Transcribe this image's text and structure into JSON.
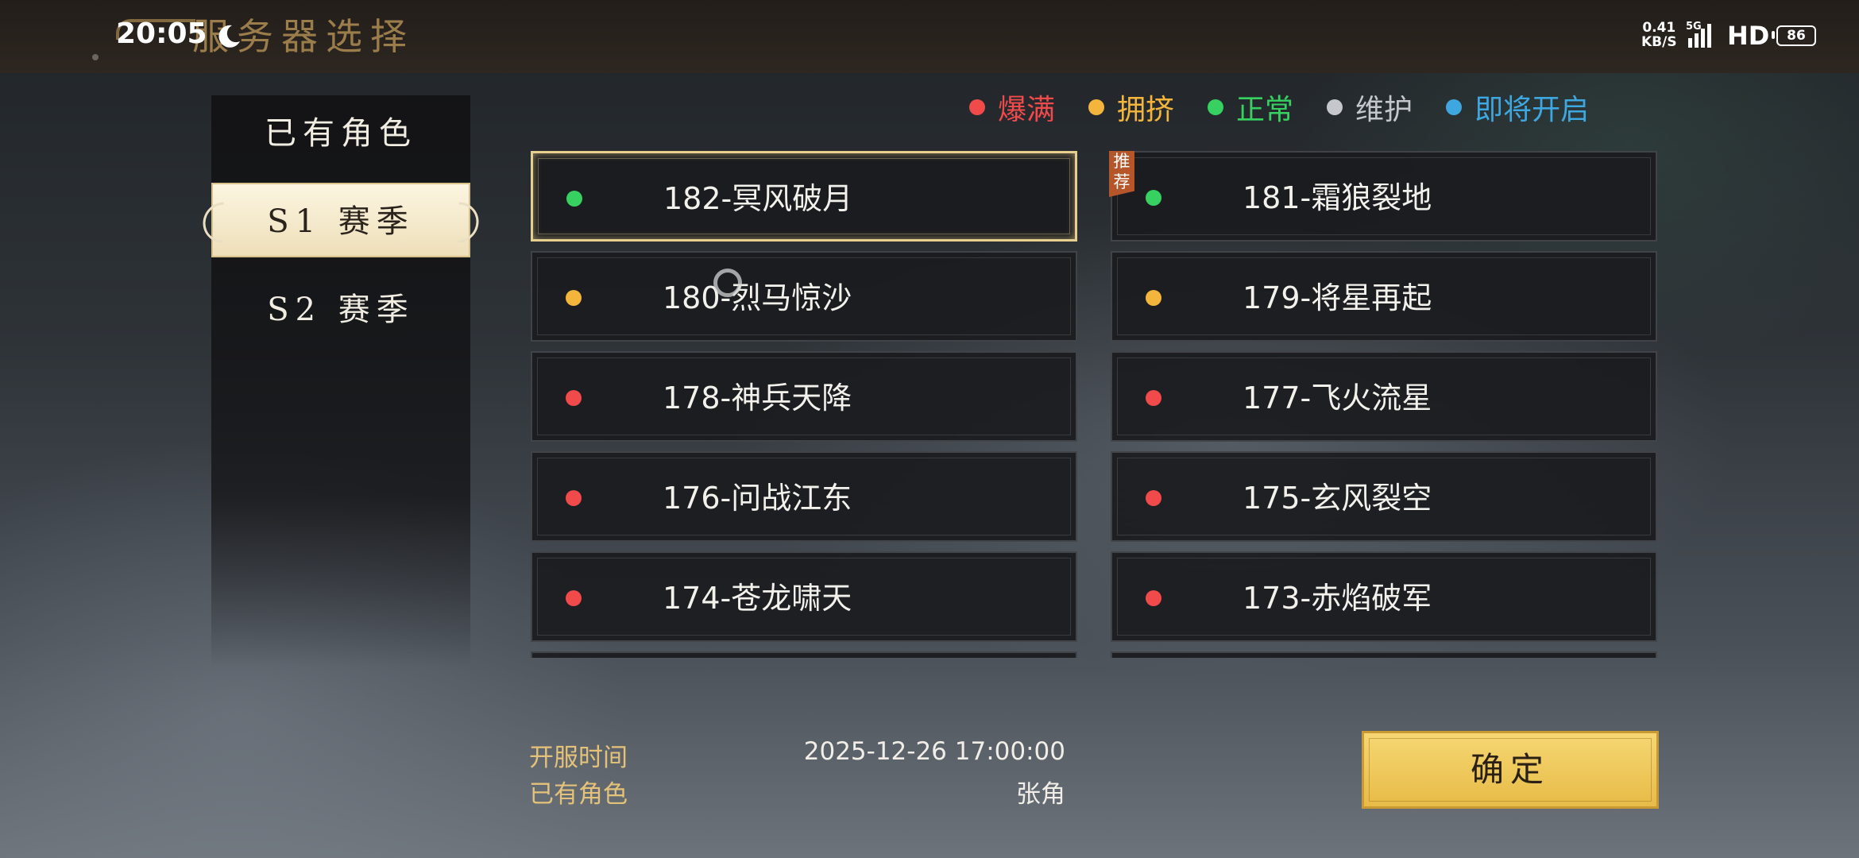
{
  "status_bar": {
    "time": "20:05",
    "net_speed_value": "0.41",
    "net_speed_unit": "KB/S",
    "network": "5G",
    "hd": "HD",
    "battery": "86"
  },
  "header": {
    "title": "服务器选择"
  },
  "sidebar": {
    "items": [
      {
        "label": "已有角色",
        "active": false
      },
      {
        "label": "S1 赛季",
        "active": true
      },
      {
        "label": "S2 赛季",
        "active": false
      }
    ]
  },
  "legend": [
    {
      "label": "爆满",
      "color": "#f04a4a"
    },
    {
      "label": "拥挤",
      "color": "#f3b53b"
    },
    {
      "label": "正常",
      "color": "#36d160"
    },
    {
      "label": "维护",
      "color": "#c4c8cc"
    },
    {
      "label": "即将开启",
      "color": "#3fa7e0"
    }
  ],
  "servers": [
    {
      "name": "182-冥风破月",
      "status": "正常",
      "color": "#36d160",
      "selected": true,
      "recommended": false
    },
    {
      "name": "181-霜狼裂地",
      "status": "正常",
      "color": "#36d160",
      "selected": false,
      "recommended": true
    },
    {
      "name": "180-烈马惊沙",
      "status": "拥挤",
      "color": "#f3b53b",
      "selected": false,
      "recommended": false
    },
    {
      "name": "179-将星再起",
      "status": "拥挤",
      "color": "#f3b53b",
      "selected": false,
      "recommended": false
    },
    {
      "name": "178-神兵天降",
      "status": "爆满",
      "color": "#f04a4a",
      "selected": false,
      "recommended": false
    },
    {
      "name": "177-飞火流星",
      "status": "爆满",
      "color": "#f04a4a",
      "selected": false,
      "recommended": false
    },
    {
      "name": "176-问战江东",
      "status": "爆满",
      "color": "#f04a4a",
      "selected": false,
      "recommended": false
    },
    {
      "name": "175-玄风裂空",
      "status": "爆满",
      "color": "#f04a4a",
      "selected": false,
      "recommended": false
    },
    {
      "name": "174-苍龙啸天",
      "status": "爆满",
      "color": "#f04a4a",
      "selected": false,
      "recommended": false
    },
    {
      "name": "173-赤焰破军",
      "status": "爆满",
      "color": "#f04a4a",
      "selected": false,
      "recommended": false
    }
  ],
  "recommend_badge": "推荐",
  "info": {
    "open_time_label": "开服时间",
    "open_time_value": "2025-12-26 17:00:00",
    "role_label": "已有角色",
    "role_value": "张角"
  },
  "confirm_button": "确定"
}
